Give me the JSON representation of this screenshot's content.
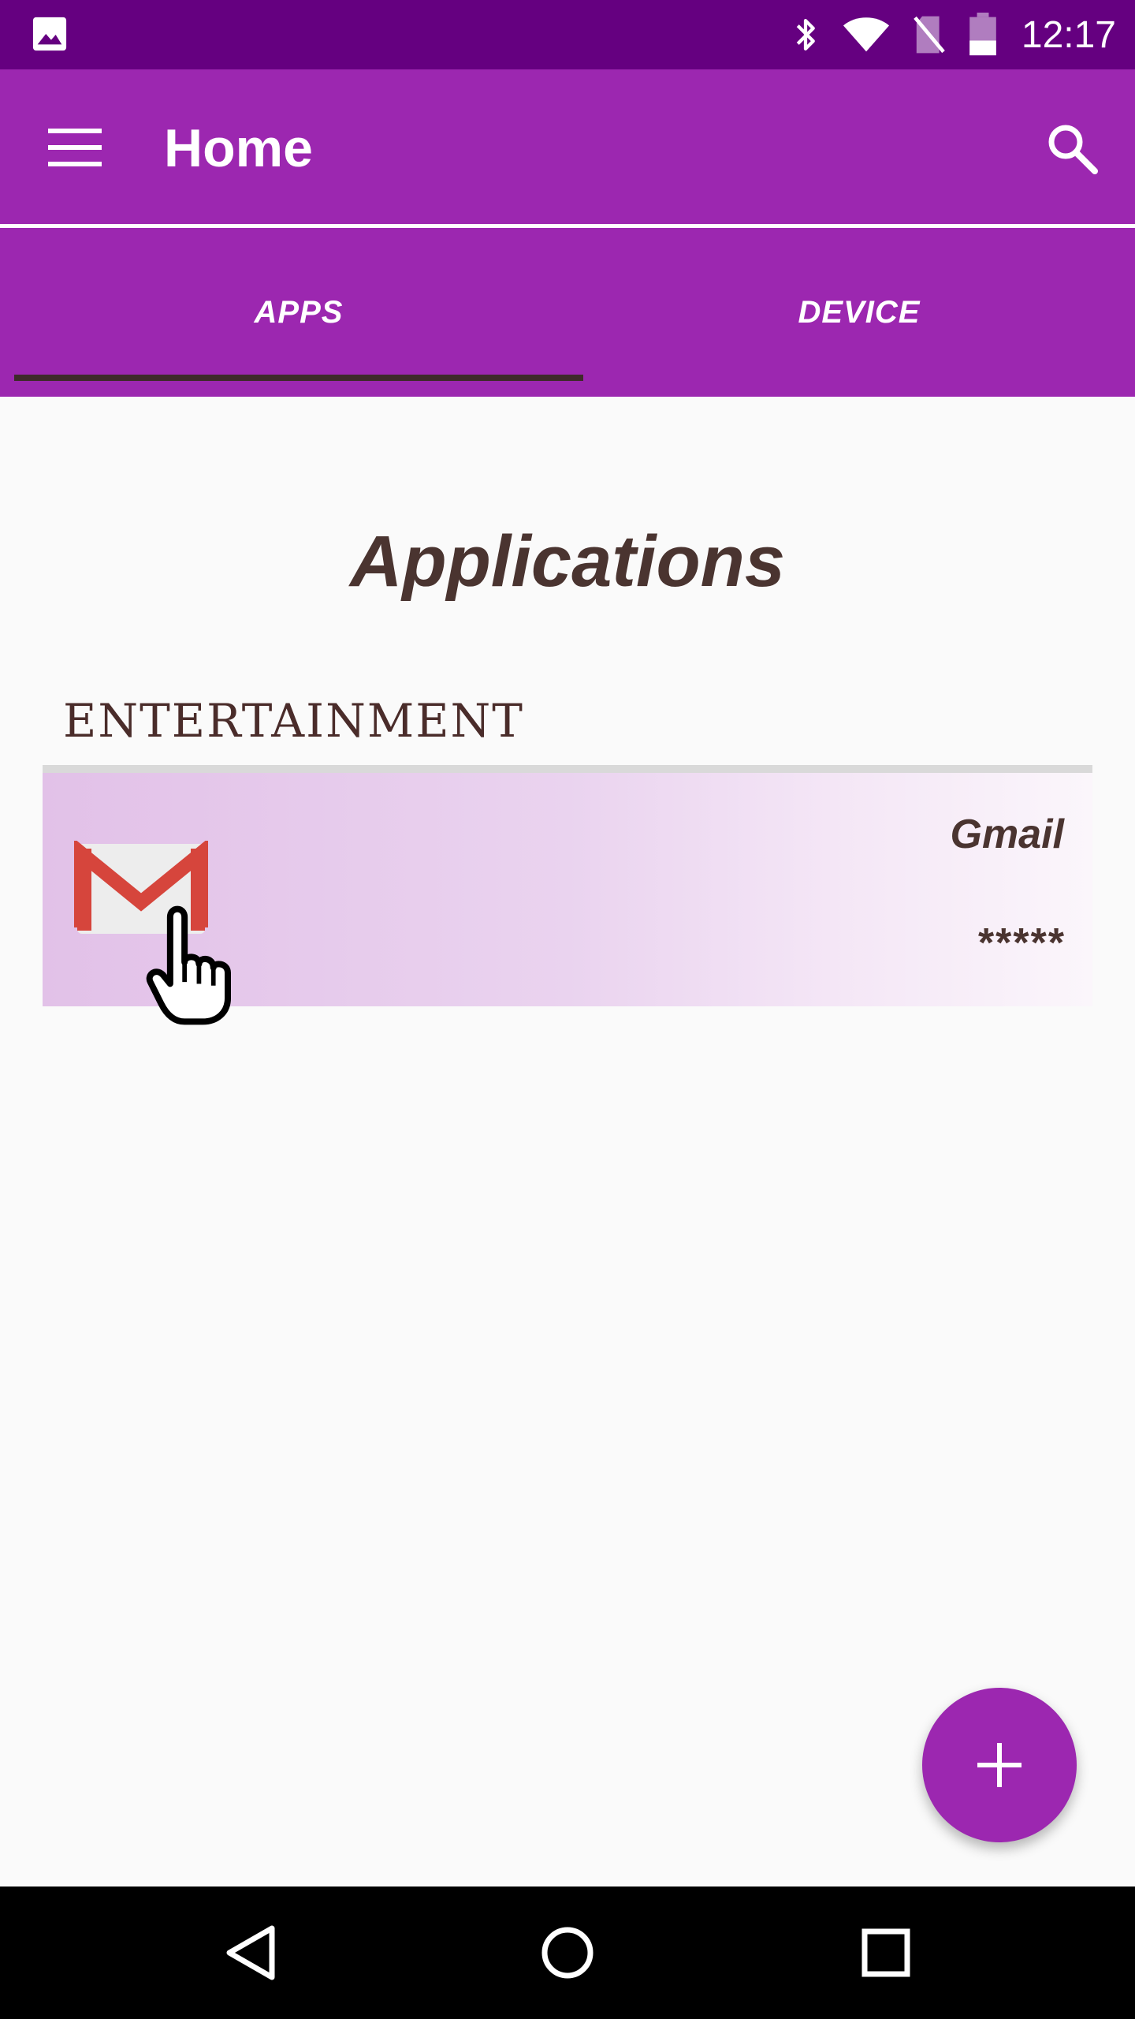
{
  "status_bar": {
    "time": "12:17",
    "icons": [
      "gallery-icon",
      "bluetooth-icon",
      "wifi-icon",
      "no-sim-icon",
      "battery-icon"
    ]
  },
  "app_bar": {
    "title": "Home",
    "menu_icon": "menu-icon",
    "search_icon": "search-icon"
  },
  "tabs": [
    {
      "label": "APPS",
      "selected": true
    },
    {
      "label": "DEVICE",
      "selected": false
    }
  ],
  "main": {
    "heading": "Applications",
    "categories": [
      {
        "label": "ENTERTAINMENT",
        "items": [
          {
            "name": "Gmail",
            "password": "*****",
            "icon": "gmail-icon"
          }
        ]
      }
    ]
  },
  "fab": {
    "icon": "plus-icon"
  },
  "nav_bar": {
    "icons": [
      "back-icon",
      "home-icon",
      "recents-icon"
    ]
  },
  "colors": {
    "primary": "#9c27b0",
    "primary_dark": "#650080",
    "text_dark": "#4a3430",
    "background": "#fafafa"
  }
}
